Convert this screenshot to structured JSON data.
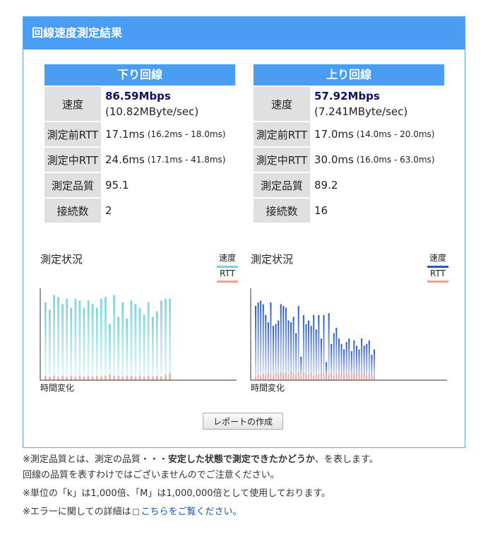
{
  "panel": {
    "title": "回線速度測定結果"
  },
  "download": {
    "title": "下り回線",
    "labels": {
      "speed": "速度",
      "rtt_before": "測定前RTT",
      "rtt_during": "測定中RTT",
      "quality": "測定品質",
      "connections": "接続数"
    },
    "speed_mbps": "86.59Mbps",
    "speed_mbyte": "(10.82MByte/sec)",
    "rtt_before": "17.1ms",
    "rtt_before_range": "(16.2ms - 18.0ms)",
    "rtt_during": "24.6ms",
    "rtt_during_range": "(17.1ms - 41.8ms)",
    "quality": "95.1",
    "connections": "2"
  },
  "upload": {
    "title": "上り回線",
    "labels": {
      "speed": "速度",
      "rtt_before": "測定前RTT",
      "rtt_during": "測定中RTT",
      "quality": "測定品質",
      "connections": "接続数"
    },
    "speed_mbps": "57.92Mbps",
    "speed_mbyte": "(7.241MByte/sec)",
    "rtt_before": "17.0ms",
    "rtt_before_range": "(14.0ms - 20.0ms)",
    "rtt_during": "30.0ms",
    "rtt_during_range": "(16.0ms - 63.0ms)",
    "quality": "89.2",
    "connections": "16"
  },
  "charts": {
    "title": "測定状況",
    "legend_speed": "速度",
    "legend_rtt": "RTT",
    "xlabel": "時間変化",
    "down_speed_color": "#79d3da",
    "up_speed_color": "#2a56c6",
    "rtt_color": "#f0a090"
  },
  "chart_data": [
    {
      "type": "bar",
      "series": [
        {
          "name": "速度",
          "values": [
            0.86,
            0.78,
            0.94,
            0.92,
            0.84,
            0.9,
            0.8,
            0.9,
            0.88,
            0.8,
            0.88,
            0.84,
            0.8,
            0.9,
            0.92,
            0.62,
            0.94,
            0.7,
            0.86,
            0.68,
            0.88,
            0.84,
            0.8,
            0.72,
            0.86,
            0.7,
            0.76,
            0.88,
            0.9,
            0.9
          ]
        },
        {
          "name": "RTT",
          "values": [
            0.05,
            0.04,
            0.05,
            0.04,
            0.05,
            0.04,
            0.05,
            0.04,
            0.05,
            0.04,
            0.05,
            0.04,
            0.05,
            0.04,
            0.05,
            0.06,
            0.05,
            0.05,
            0.04,
            0.05,
            0.05,
            0.04,
            0.05,
            0.04,
            0.05,
            0.04,
            0.05,
            0.04,
            0.06,
            0.08
          ]
        }
      ]
    },
    {
      "type": "bar",
      "series": [
        {
          "name": "速度",
          "values": [
            0.82,
            0.86,
            0.88,
            0.84,
            0.72,
            0.64,
            0.86,
            0.6,
            0.62,
            0.66,
            0.84,
            0.82,
            0.8,
            0.66,
            0.64,
            0.7,
            0.52,
            0.82,
            0.26,
            0.72,
            0.62,
            0.66,
            0.6,
            0.72,
            0.56,
            0.72,
            0.46,
            0.72,
            0.2,
            0.74,
            0.4,
            0.52,
            0.58,
            0.46,
            0.4,
            0.34,
            0.42,
            0.46,
            0.32,
            0.44,
            0.38,
            0.34,
            0.46,
            0.38,
            0.4,
            0.44,
            0.28,
            0.34
          ]
        },
        {
          "name": "RTT",
          "values": [
            0.04,
            0.06,
            0.05,
            0.07,
            0.06,
            0.08,
            0.07,
            0.05,
            0.08,
            0.06,
            0.09,
            0.07,
            0.08,
            0.06,
            0.1,
            0.07,
            0.06,
            0.09,
            0.05,
            0.08,
            0.07,
            0.06,
            0.08,
            0.05,
            0.07,
            0.06,
            0.08,
            0.07,
            0.09,
            0.06,
            0.08,
            0.05,
            0.07,
            0.06,
            0.09,
            0.06,
            0.08,
            0.07,
            0.06,
            0.08,
            0.07,
            0.09,
            0.06,
            0.08,
            0.05,
            0.07,
            0.06,
            0.05
          ]
        }
      ]
    }
  ],
  "report_button": "レポートの作成",
  "notes": {
    "line1_a": "※測定品質とは、測定の品質・・・",
    "line1_b": "安定した状態で測定できたかどうか",
    "line1_c": "、を表します。",
    "line2": "回線の品質を表すわけではございませんのでご注意ください。",
    "line3": "※単位の「k」は1,000倍、「M」は1,000,000倍として使用しております。",
    "line4_a": "※エラーに関しての詳細は",
    "line4_link": "こちらをご覧ください。"
  }
}
